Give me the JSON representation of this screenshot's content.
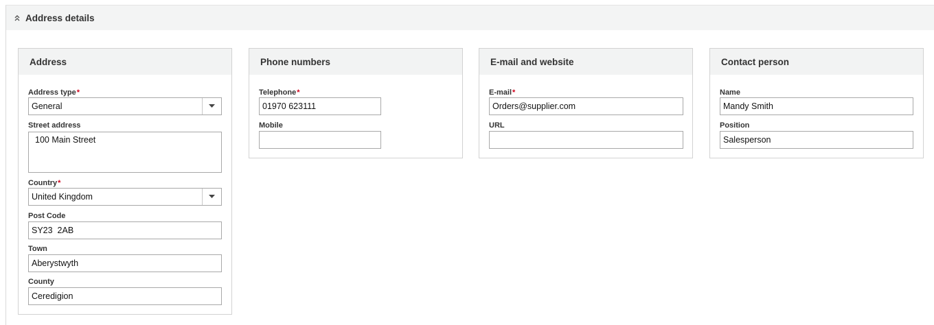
{
  "section": {
    "title": "Address details",
    "icon": "double-chevron-up-icon"
  },
  "address_card": {
    "title": "Address",
    "address_type": {
      "label": "Address type",
      "required_mark": "*",
      "value": "General"
    },
    "street_address": {
      "label": "Street address",
      "value": "100 Main Street"
    },
    "country": {
      "label": "Country",
      "required_mark": "*",
      "value": "United Kingdom"
    },
    "post_code": {
      "label": "Post Code",
      "value": "SY23  2AB"
    },
    "town": {
      "label": "Town",
      "value": "Aberystwyth"
    },
    "county": {
      "label": "County",
      "value": "Ceredigion"
    }
  },
  "phone_card": {
    "title": "Phone numbers",
    "telephone": {
      "label": "Telephone",
      "required_mark": "*",
      "value": "01970 623111"
    },
    "mobile": {
      "label": "Mobile",
      "value": ""
    }
  },
  "email_card": {
    "title": "E-mail and website",
    "email": {
      "label": "E-mail",
      "required_mark": "*",
      "value": "Orders@supplier.com"
    },
    "url": {
      "label": "URL",
      "value": ""
    }
  },
  "contact_card": {
    "title": "Contact person",
    "name": {
      "label": "Name",
      "value": "Mandy Smith"
    },
    "position": {
      "label": "Position",
      "value": "Salesperson"
    }
  },
  "colors": {
    "required": "#d0021b",
    "header_bg": "#f2f3f3",
    "border": "#d2d2d2"
  }
}
